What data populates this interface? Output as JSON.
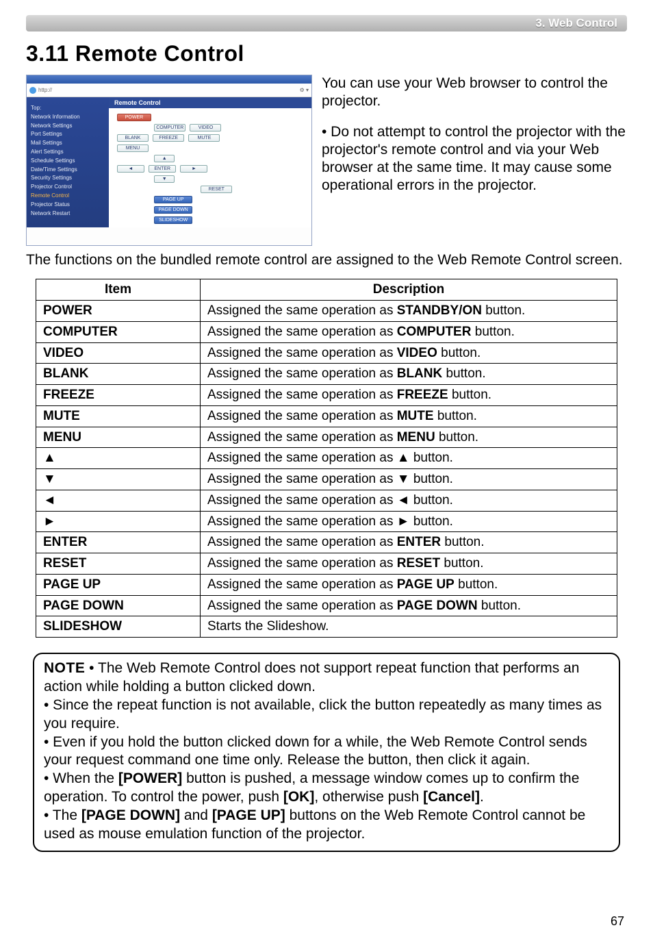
{
  "header": {
    "chapter_label": "3. Web Control"
  },
  "title": "3.11 Remote Control",
  "screenshot": {
    "panel_title": "Remote Control",
    "sidebar": [
      "Top:",
      "Network Information",
      "Network Settings",
      "Port Settings",
      "Mail Settings",
      "Alert Settings",
      "Schedule Settings",
      "Date/Time Settings",
      "Security Settings",
      "Projector Control",
      "Remote Control",
      "Projector Status",
      "Network Restart"
    ],
    "sidebar_highlight_index": 10,
    "buttons": {
      "power": "POWER",
      "computer": "COMPUTER",
      "video": "VIDEO",
      "blank": "BLANK",
      "freeze": "FREEZE",
      "mute": "MUTE",
      "menu": "MENU",
      "up": "▲",
      "left": "◄",
      "enter": "ENTER",
      "right": "►",
      "down": "▼",
      "reset": "RESET",
      "page_up": "PAGE UP",
      "page_down": "PAGE DOWN",
      "slideshow": "SLIDESHOW"
    }
  },
  "intro": {
    "p1": "You can use your Web browser to control the projector.",
    "p2": "• Do not attempt to control the projector with the projector's remote control and via your Web browser at the same time. It may cause some operational errors in the projector."
  },
  "below_intro": "The functions on the bundled remote control are assigned to the Web Remote Control screen.",
  "table": {
    "headers": {
      "item": "Item",
      "desc": "Description"
    },
    "rows": [
      {
        "item": "POWER",
        "desc_pre": "Assigned the same operation as ",
        "desc_bold": "STANDBY/ON",
        "desc_post": " button."
      },
      {
        "item": "COMPUTER",
        "desc_pre": "Assigned the same operation as ",
        "desc_bold": "COMPUTER",
        "desc_post": " button."
      },
      {
        "item": "VIDEO",
        "desc_pre": "Assigned the same operation as ",
        "desc_bold": "VIDEO",
        "desc_post": " button."
      },
      {
        "item": "BLANK",
        "desc_pre": "Assigned the same operation as ",
        "desc_bold": "BLANK",
        "desc_post": " button."
      },
      {
        "item": "FREEZE",
        "desc_pre": "Assigned the same operation as ",
        "desc_bold": "FREEZE",
        "desc_post": " button."
      },
      {
        "item": "MUTE",
        "desc_pre": "Assigned the same operation as ",
        "desc_bold": "MUTE",
        "desc_post": " button."
      },
      {
        "item": "MENU",
        "desc_pre": "Assigned the same operation as ",
        "desc_bold": "MENU",
        "desc_post": " button."
      },
      {
        "item": "▲",
        "desc_pre": "Assigned the same operation as ",
        "desc_bold": "▲",
        "desc_post": " button."
      },
      {
        "item": "▼",
        "desc_pre": "Assigned the same operation as ",
        "desc_bold": "▼",
        "desc_post": " button."
      },
      {
        "item": "◄",
        "desc_pre": "Assigned the same operation as ",
        "desc_bold": "◄",
        "desc_post": " button."
      },
      {
        "item": "►",
        "desc_pre": "Assigned the same operation as ",
        "desc_bold": "►",
        "desc_post": " button."
      },
      {
        "item": "ENTER",
        "desc_pre": "Assigned the same operation as ",
        "desc_bold": "ENTER",
        "desc_post": " button."
      },
      {
        "item": "RESET",
        "desc_pre": "Assigned the same operation as ",
        "desc_bold": "RESET",
        "desc_post": " button."
      },
      {
        "item": "PAGE UP",
        "desc_pre": "Assigned the same operation as ",
        "desc_bold": "PAGE UP",
        "desc_post": " button."
      },
      {
        "item": "PAGE DOWN",
        "desc_pre": "Assigned the same operation as ",
        "desc_bold": "PAGE DOWN",
        "desc_post": " button."
      },
      {
        "item": "SLIDESHOW",
        "desc_pre": "Starts the Slideshow.",
        "desc_bold": "",
        "desc_post": ""
      }
    ]
  },
  "note": {
    "label": "NOTE",
    "b1a": " • The Web Remote Control does not support repeat function that performs an action while holding a button clicked down.",
    "b2": "• Since the repeat function is not available, click the button repeatedly as many times as you require.",
    "b3": "• Even if you hold the button clicked down for a while, the Web Remote Control sends your request command one time only. Release the button, then click it again.",
    "b4_pre": "• When the ",
    "b4_bold1": "[POWER]",
    "b4_mid": " button is pushed, a message window comes up to confirm the operation. To control the power, push ",
    "b4_bold2": "[OK]",
    "b4_mid2": ", otherwise push ",
    "b4_bold3": "[Cancel]",
    "b4_post": ".",
    "b5_pre": "• The ",
    "b5_bold1": "[PAGE DOWN]",
    "b5_mid": " and ",
    "b5_bold2": "[PAGE UP]",
    "b5_post": " buttons on the Web Remote Control cannot be used as mouse emulation function of the projector."
  },
  "page_number": "67"
}
